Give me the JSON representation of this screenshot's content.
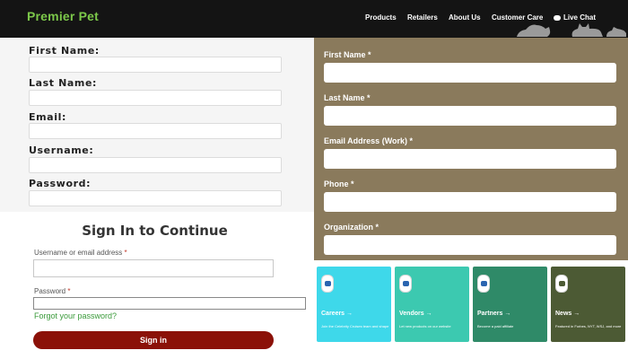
{
  "header": {
    "logo": "Premier Pet",
    "nav": [
      "Products",
      "Retailers",
      "About Us",
      "Customer Care"
    ],
    "live_chat": "Live Chat"
  },
  "left_form": {
    "fields": [
      {
        "label": "First Name:"
      },
      {
        "label": "Last Name:"
      },
      {
        "label": "Email:"
      },
      {
        "label": "Username:"
      },
      {
        "label": "Password:"
      }
    ]
  },
  "signin": {
    "title": "Sign In to Continue",
    "username_label": "Username or email address",
    "password_label": "Password",
    "required_mark": "*",
    "forgot": "Forgot your password?",
    "button": "Sign in"
  },
  "right_form": {
    "fields": [
      {
        "label": "First Name *"
      },
      {
        "label": "Last Name *"
      },
      {
        "label": "Email Address (Work) *"
      },
      {
        "label": "Phone *"
      },
      {
        "label": "Organization *"
      }
    ]
  },
  "cards": [
    {
      "title": "Careers →",
      "sub": "Join the Celebrity Cruises team and shape your career",
      "color": "#3ed8ea",
      "icon_color": "#2a64b0"
    },
    {
      "title": "Vendors →",
      "sub": "Let new products on our website",
      "color": "#3cc9b0",
      "icon_color": "#2a64b0"
    },
    {
      "title": "Partners →",
      "sub": "Become a paid affiliate",
      "color": "#2f8a68",
      "icon_color": "#2a64b0"
    },
    {
      "title": "News →",
      "sub": "Featured in Forbes, NYT, WSJ, and more",
      "color": "#4c5a34",
      "icon_color": "#4c5a34"
    }
  ],
  "colors": {
    "brand_green": "#7cc84a",
    "nav_bg": "#141414",
    "right_form_bg": "#8a7a5c",
    "signin_button": "#8b1108",
    "link_green": "#3a9a3a"
  }
}
